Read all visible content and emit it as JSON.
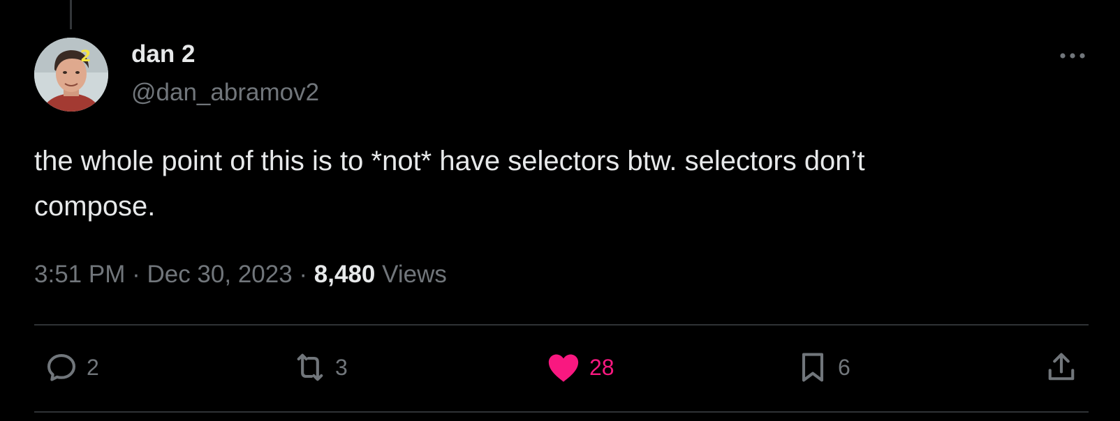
{
  "tweet": {
    "display_name": "dan 2",
    "handle": "@dan_abramov2",
    "avatar_badge": "2",
    "text": "the whole point of this is to *not* have selectors btw. selectors don’t\ncompose.",
    "time": "3:51 PM",
    "separator": " · ",
    "date": "Dec 30, 2023",
    "views_count": "8,480",
    "views_label": " Views"
  },
  "actions": {
    "reply": {
      "icon": "reply-icon",
      "count": "2"
    },
    "retweet": {
      "icon": "retweet-icon",
      "count": "3"
    },
    "like": {
      "icon": "heart-icon",
      "count": "28",
      "active": true
    },
    "bookmark": {
      "icon": "bookmark-icon",
      "count": "6"
    },
    "share": {
      "icon": "share-icon"
    }
  },
  "colors": {
    "background": "#000000",
    "text_primary": "#e7e9ea",
    "text_secondary": "#71767b",
    "divider": "#2f3336",
    "like_active": "#f91880",
    "avatar_badge": "#f5e642"
  }
}
